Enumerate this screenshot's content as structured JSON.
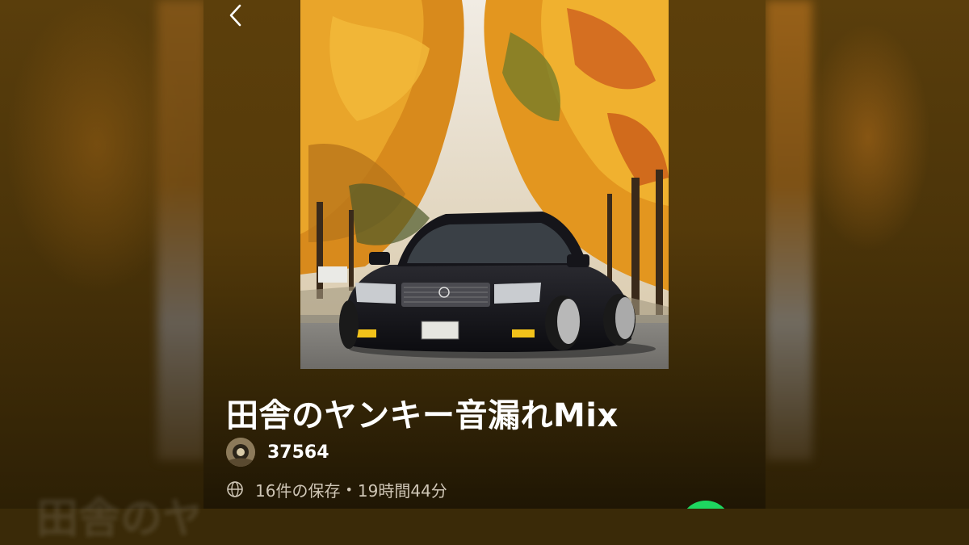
{
  "playlist": {
    "title": "田舎のヤンキー音漏れMix",
    "owner": "37564",
    "saves": "16件の保存",
    "separator": "•",
    "duration": "19時間44分"
  },
  "icons": {
    "back": "chevron-left-icon",
    "visibility": "globe-icon",
    "play": "play-button"
  },
  "colors": {
    "accent": "#1ed760",
    "panel_top": "#5c3f0b",
    "text_primary": "#ffffff",
    "text_secondary": "#cfc6b6"
  }
}
